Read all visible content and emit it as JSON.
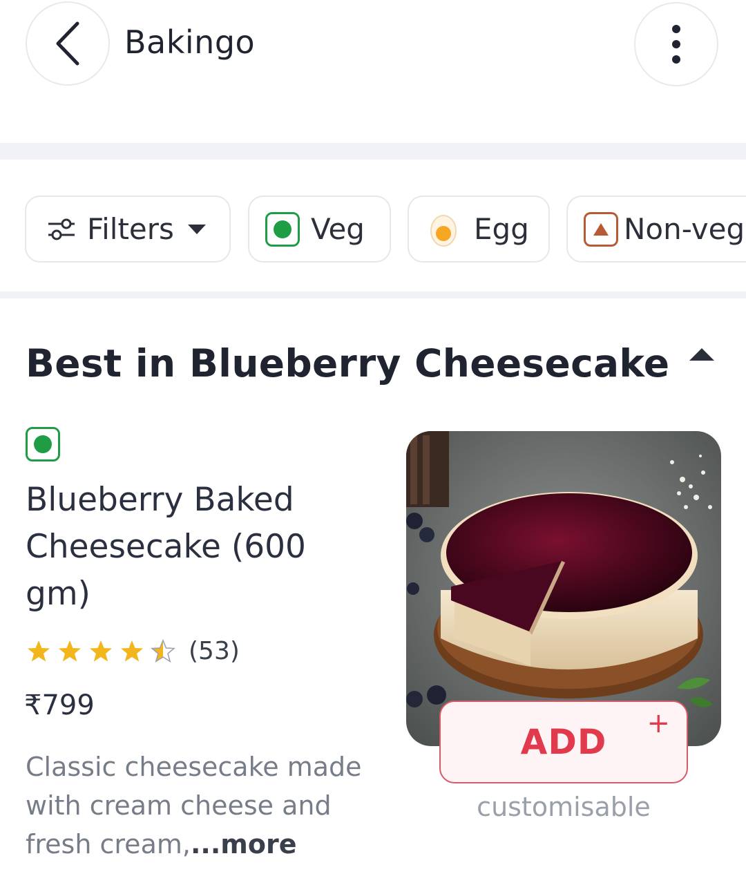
{
  "header": {
    "title": "Bakingo",
    "back_icon": "chevron-left-icon",
    "menu_icon": "more-vertical-icon"
  },
  "filters": {
    "filters_label": "Filters",
    "veg_label": "Veg",
    "egg_label": "Egg",
    "nonveg_label": "Non-veg"
  },
  "section": {
    "title": "Best in Blueberry Cheesecake",
    "collapse_icon": "caret-up-icon"
  },
  "product": {
    "diet_icon": "veg-indicator-icon",
    "name": "Blueberry Baked Cheesecake (600 gm)",
    "rating_stars": 4.5,
    "rating_count": "(53)",
    "price": "₹799",
    "description": "Classic cheesecake made with cream cheese and fresh cream,",
    "more_label": "...more",
    "add_label": "ADD",
    "add_plus": "+",
    "customisable_label": "customisable"
  },
  "colors": {
    "veg_green": "#1f9d45",
    "nonveg_brown": "#b75a36",
    "add_red": "#e03a4c",
    "star_gold": "#f2b51b"
  }
}
